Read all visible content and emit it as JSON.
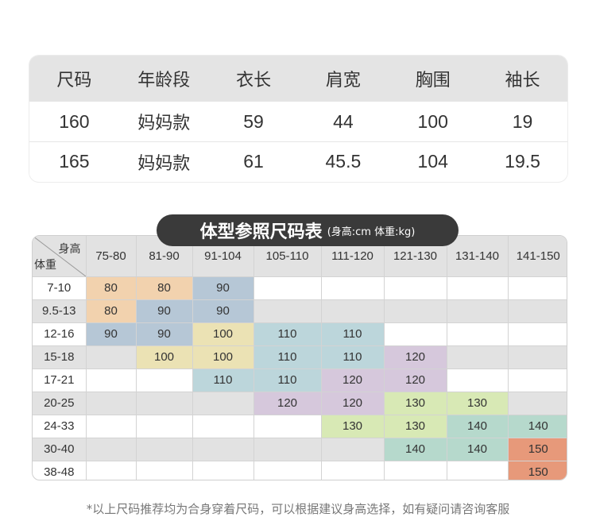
{
  "size_table": {
    "headers": [
      "尺码",
      "年龄段",
      "衣长",
      "肩宽",
      "胸围",
      "袖长"
    ],
    "rows": [
      [
        "160",
        "妈妈款",
        "59",
        "44",
        "100",
        "19"
      ],
      [
        "165",
        "妈妈款",
        "61",
        "45.5",
        "104",
        "19.5"
      ]
    ]
  },
  "title": {
    "main": "体型参照尺码表",
    "sub": "(身高:cm 体重:kg)"
  },
  "grid": {
    "corner_height_label": "身高",
    "corner_weight_label": "体重",
    "height_ranges": [
      "75-80",
      "81-90",
      "91-104",
      "105-110",
      "111-120",
      "121-130",
      "131-140",
      "141-150"
    ],
    "rows": [
      {
        "weight": "7-10",
        "cells": [
          "80",
          "80",
          "90",
          "",
          "",
          "",
          "",
          ""
        ],
        "fills": [
          "orange",
          "orange",
          "blue",
          "",
          "",
          "",
          "",
          ""
        ]
      },
      {
        "weight": "9.5-13",
        "cells": [
          "80",
          "90",
          "90",
          "",
          "",
          "",
          "",
          ""
        ],
        "fills": [
          "orange",
          "blue",
          "blue",
          "",
          "",
          "",
          "",
          ""
        ]
      },
      {
        "weight": "12-16",
        "cells": [
          "90",
          "90",
          "100",
          "110",
          "110",
          "",
          "",
          ""
        ],
        "fills": [
          "blue",
          "blue",
          "yellow",
          "teal",
          "teal",
          "",
          "",
          ""
        ]
      },
      {
        "weight": "15-18",
        "cells": [
          "",
          "100",
          "100",
          "110",
          "110",
          "120",
          "",
          ""
        ],
        "fills": [
          "",
          "yellow",
          "yellow",
          "teal",
          "teal",
          "purple",
          "",
          ""
        ]
      },
      {
        "weight": "17-21",
        "cells": [
          "",
          "",
          "110",
          "110",
          "120",
          "120",
          "",
          ""
        ],
        "fills": [
          "",
          "",
          "teal",
          "teal",
          "purple",
          "purple",
          "",
          ""
        ]
      },
      {
        "weight": "20-25",
        "cells": [
          "",
          "",
          "",
          "120",
          "120",
          "130",
          "130",
          ""
        ],
        "fills": [
          "",
          "",
          "",
          "purple",
          "purple",
          "green",
          "green",
          ""
        ]
      },
      {
        "weight": "24-33",
        "cells": [
          "",
          "",
          "",
          "",
          "130",
          "130",
          "140",
          "140"
        ],
        "fills": [
          "",
          "",
          "",
          "",
          "green",
          "green",
          "mint",
          "mint"
        ]
      },
      {
        "weight": "30-40",
        "cells": [
          "",
          "",
          "",
          "",
          "",
          "140",
          "140",
          "150"
        ],
        "fills": [
          "",
          "",
          "",
          "",
          "",
          "mint",
          "mint",
          "coral"
        ]
      },
      {
        "weight": "38-48",
        "cells": [
          "",
          "",
          "",
          "",
          "",
          "",
          "",
          "150"
        ],
        "fills": [
          "",
          "",
          "",
          "",
          "",
          "",
          "",
          "coral"
        ]
      }
    ],
    "fill_colors": {
      "orange": "#f2d2ae",
      "blue": "#b6c7d6",
      "yellow": "#ebe2b4",
      "teal": "#bcd6db",
      "purple": "#d6c8dc",
      "green": "#d8e9b5",
      "mint": "#b6d9cc",
      "coral": "#e7997a"
    }
  },
  "footnote": "*以上尺码推荐均为合身穿着尺码，可以根据建议身高选择，如有疑问请咨询客服"
}
